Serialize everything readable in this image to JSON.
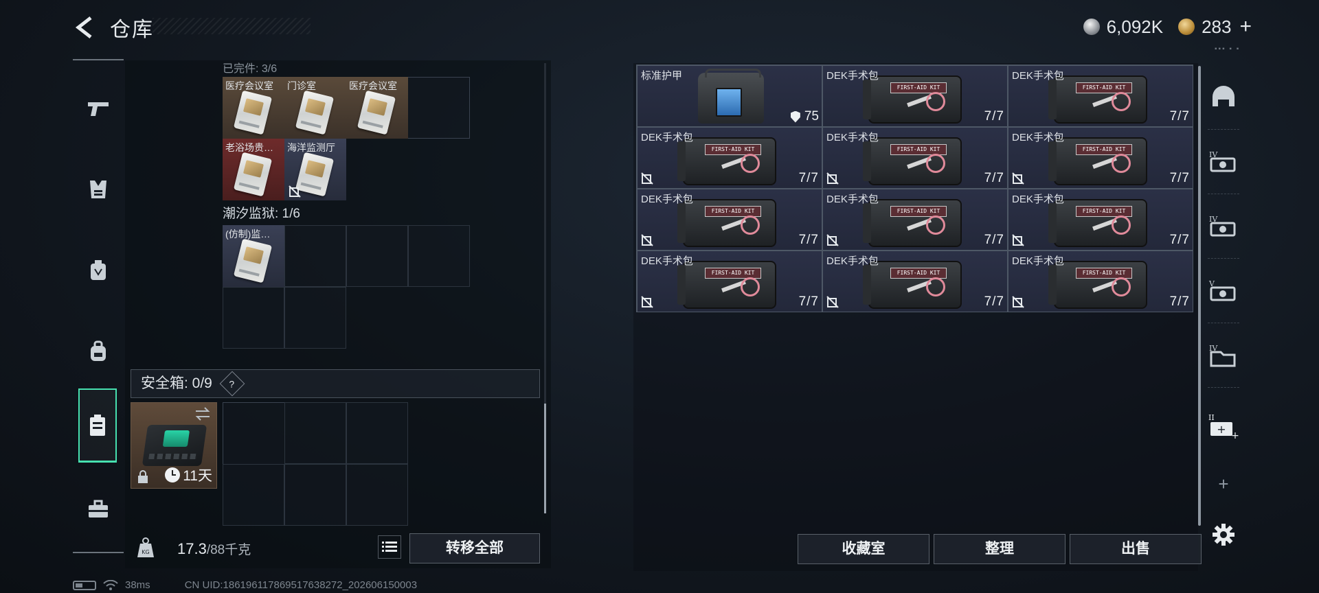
{
  "header": {
    "title": "仓库",
    "currency_primary": "6,092K",
    "currency_secondary": "283",
    "add_label": "+"
  },
  "left_nav": {
    "items": [
      {
        "icon": "pistol-icon"
      },
      {
        "icon": "armor-vest-icon"
      },
      {
        "icon": "chest-rig-icon"
      },
      {
        "icon": "backpack-icon"
      },
      {
        "icon": "secure-container-icon",
        "active": true
      },
      {
        "icon": "toolbox-icon"
      }
    ]
  },
  "containers": {
    "top_label": "已完件: 3/6",
    "top_grid_items": [
      {
        "name": "医疗会议室",
        "bg": "gold"
      },
      {
        "name": "门诊室",
        "bg": "gold"
      },
      {
        "name": "医疗会议室",
        "bg": "gold"
      },
      {
        "name": "老浴场贵…",
        "bg": "red"
      },
      {
        "name": "海洋监测厅",
        "bg": "blue",
        "no_share": true
      }
    ],
    "prison_label": "潮汐监狱: 1/6",
    "prison_items": [
      {
        "name": "(仿制)监…",
        "bg": "blue"
      }
    ]
  },
  "safe_box": {
    "label": "安全箱: 0/9",
    "help": "?",
    "timer": "11天"
  },
  "weight": {
    "current": "17.3",
    "capacity": "/88千克"
  },
  "buttons": {
    "transfer_all": "转移全部",
    "collection_room": "收藏室",
    "organize": "整理",
    "sell": "出售"
  },
  "stash": {
    "armor": {
      "name": "标准护甲",
      "value": "75"
    },
    "items": [
      {
        "name": "DEK手术包",
        "count": "7/7",
        "no_share": false
      },
      {
        "name": "DEK手术包",
        "count": "7/7",
        "no_share": false
      },
      {
        "name": "DEK手术包",
        "count": "7/7",
        "no_share": true
      },
      {
        "name": "DEK手术包",
        "count": "7/7",
        "no_share": true
      },
      {
        "name": "DEK手术包",
        "count": "7/7",
        "no_share": true
      },
      {
        "name": "DEK手术包",
        "count": "7/7",
        "no_share": true
      },
      {
        "name": "DEK手术包",
        "count": "7/7",
        "no_share": true
      },
      {
        "name": "DEK手术包",
        "count": "7/7",
        "no_share": true
      },
      {
        "name": "DEK手术包",
        "count": "7/7",
        "no_share": true
      },
      {
        "name": "DEK手术包",
        "count": "7/7",
        "no_share": true
      },
      {
        "name": "DEK手术包",
        "count": "7/7",
        "no_share": true
      }
    ]
  },
  "right_rail": {
    "items": [
      {
        "icon": "helmet-icon"
      },
      {
        "icon": "stash-tier-4-icon"
      },
      {
        "icon": "stash-tier-4b-icon"
      },
      {
        "icon": "stash-tier-5-icon"
      },
      {
        "icon": "folder-tier-4-icon"
      },
      {
        "icon": "stash-expand-icon"
      },
      {
        "icon": "plus-icon",
        "label": "+"
      },
      {
        "icon": "gear-icon"
      }
    ]
  },
  "status": {
    "ping": "38ms",
    "uid": "CN UID:1861961178695176382​72_202606150003"
  },
  "colors": {
    "accent": "#47e1b0",
    "slot_bg": "#23283a",
    "gold_bg": "#5a4a3a",
    "red_bg": "#6e2b2b"
  }
}
